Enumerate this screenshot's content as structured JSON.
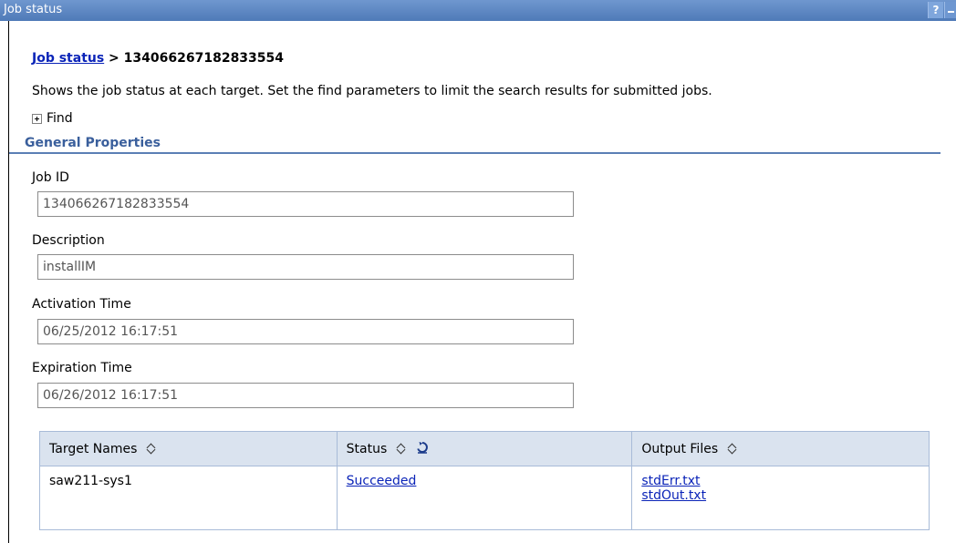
{
  "window": {
    "title": "Job status",
    "help_label": "?"
  },
  "breadcrumb": {
    "link": "Job status",
    "separator": " > ",
    "current": "134066267182833554"
  },
  "description": "Shows the job status at each target. Set the find parameters to limit the search results for submitted jobs.",
  "find": {
    "label": "Find"
  },
  "section": {
    "title": "General Properties"
  },
  "fields": [
    {
      "label": "Job ID",
      "value": "134066267182833554"
    },
    {
      "label": "Description",
      "value": "installIM"
    },
    {
      "label": "Activation Time",
      "value": "06/25/2012 16:17:51"
    },
    {
      "label": "Expiration Time",
      "value": "06/26/2012 16:17:51"
    }
  ],
  "table": {
    "columns": [
      "Target Names",
      "Status",
      "Output Files"
    ],
    "rows": [
      {
        "target": "saw211-sys1",
        "status": "Succeeded",
        "files": [
          "stdErr.txt",
          "stdOut.txt"
        ]
      }
    ]
  },
  "colors": {
    "titlebar": "#5a84c2",
    "link": "#0b24b8",
    "section": "#3a5f9c",
    "table_header": "#dae3ef"
  }
}
